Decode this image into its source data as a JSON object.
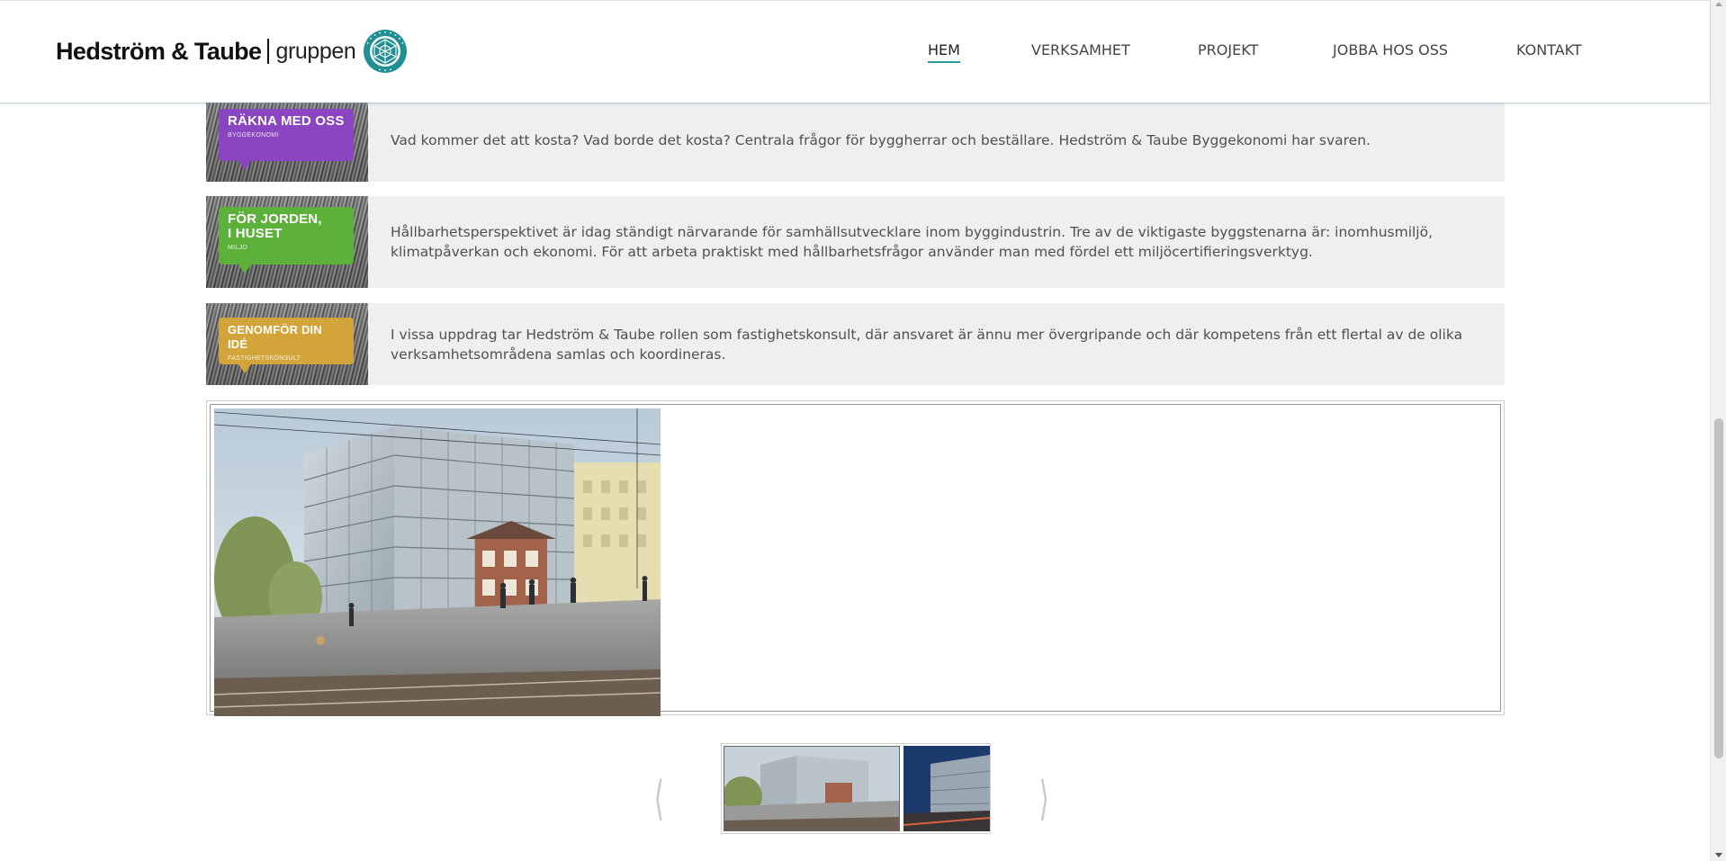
{
  "header": {
    "logo_brand": "Hedström & Taube",
    "logo_sub": "gruppen",
    "nav": [
      {
        "label": "HEM",
        "active": true
      },
      {
        "label": "VERKSAMHET",
        "active": false
      },
      {
        "label": "PROJEKT",
        "active": false
      },
      {
        "label": "JOBBA HOS OSS",
        "active": false
      },
      {
        "label": "KONTAKT",
        "active": false
      }
    ]
  },
  "services": [
    {
      "tag_title": "RÄKNA MED OSS",
      "tag_sub": "BYGGEKONOMI",
      "tag_color": "#8a45c0",
      "text": "Vad kommer det att kosta? Vad borde det kosta? Centrala frågor för byggherrar och beställare. Hedström & Taube Byggekonomi har svaren."
    },
    {
      "tag_title": "FÖR JORDEN,\nI HUSET",
      "tag_sub": "MILJÖ",
      "tag_color": "#5cb13a",
      "text": "Hållbarhetsperspektivet är idag ständigt närvarande för samhällsutvecklare inom byggindustrin. Tre av de viktigaste byggstenarna är: inomhusmiljö, klimatpåverkan och ekonomi. För att arbeta praktiskt med hållbarhetsfrågor använder man med fördel ett miljöcertifieringsverktyg."
    },
    {
      "tag_title": "GENOMFÖR DIN IDÉ",
      "tag_sub": "FASTIGHETSKONSULT",
      "tag_color": "#d2a43a",
      "text": "I vissa uppdrag tar Hedström & Taube rollen som fastighetskonsult, där ansvaret är ännu mer övergripande och där kompetens från ett flertal av de olika verksamhetsområdena samlas och koordineras."
    }
  ],
  "slider": {
    "prev_symbol": "⟨",
    "next_symbol": "⟩"
  },
  "colors": {
    "accent": "#2a9a9a",
    "row_bg": "#efefef",
    "text": "#505050"
  }
}
